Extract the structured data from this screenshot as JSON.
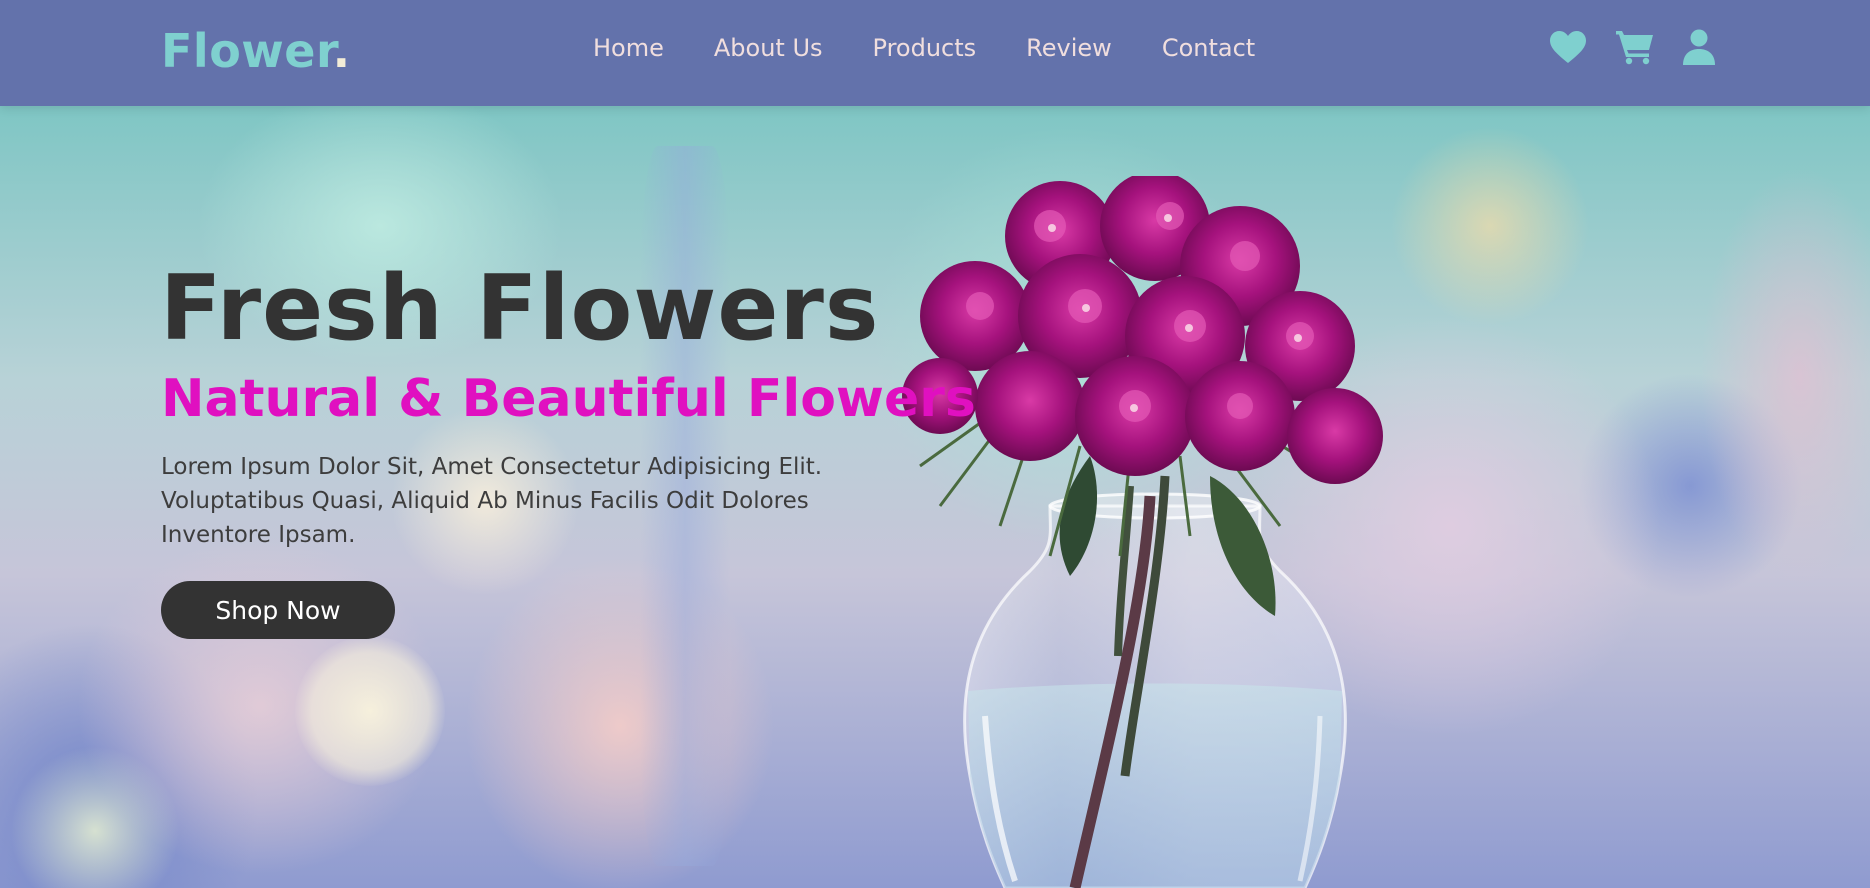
{
  "header": {
    "logo_text": "Flower",
    "logo_dot": ".",
    "nav": [
      {
        "label": "Home"
      },
      {
        "label": "About Us"
      },
      {
        "label": "Products"
      },
      {
        "label": "Review"
      },
      {
        "label": "Contact"
      }
    ],
    "icons": [
      "heart-icon",
      "cart-icon",
      "user-icon"
    ]
  },
  "hero": {
    "title": "Fresh Flowers",
    "subtitle": "Natural & Beautiful Flowers",
    "description": "Lorem Ipsum Dolor Sit, Amet Consectetur Adipisicing Elit. Voluptatibus Quasi, Aliquid Ab Minus Facilis Odit Dolores Inventore Ipsam.",
    "button_label": "Shop Now",
    "image": "flower-vase-image"
  },
  "colors": {
    "header_bg": "#6372ab",
    "accent_teal": "#7fd0cf",
    "nav_text": "#f0dede",
    "subtitle_magenta": "#e010c0",
    "dark_text": "#333333"
  }
}
